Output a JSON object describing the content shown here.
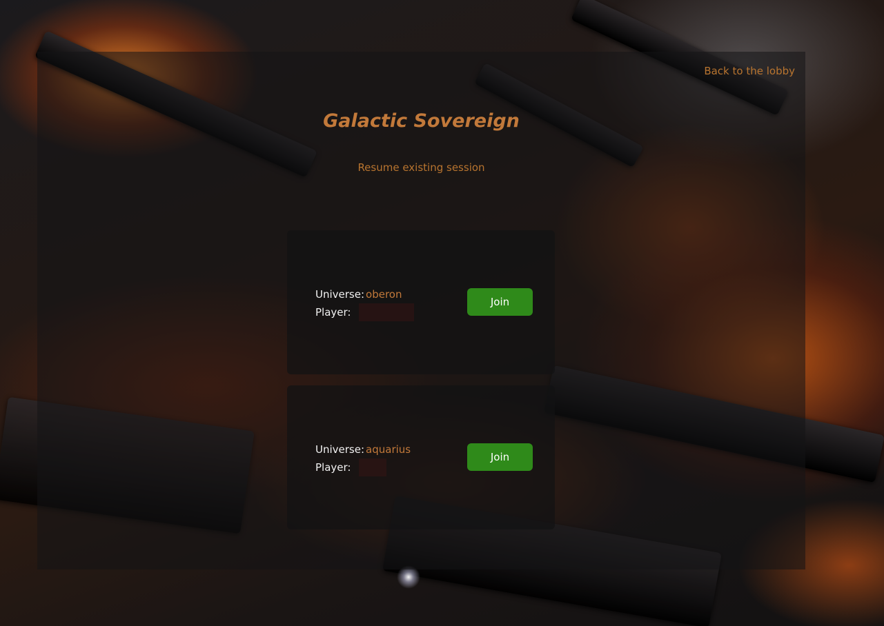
{
  "header": {
    "back_link": "Back to the lobby"
  },
  "main": {
    "title": "Galactic Sovereign",
    "subtitle": "Resume existing session"
  },
  "sessions": [
    {
      "universe_label": "Universe:",
      "universe_name": "oberon",
      "player_label": "Player:",
      "player_name": "",
      "join_label": "Join"
    },
    {
      "universe_label": "Universe:",
      "universe_name": "aquarius",
      "player_label": "Player:",
      "player_name": "",
      "join_label": "Join"
    }
  ],
  "colors": {
    "accent": "#c2793a",
    "join_button": "#2f8a1a",
    "label_text": "#f2f2f2"
  }
}
